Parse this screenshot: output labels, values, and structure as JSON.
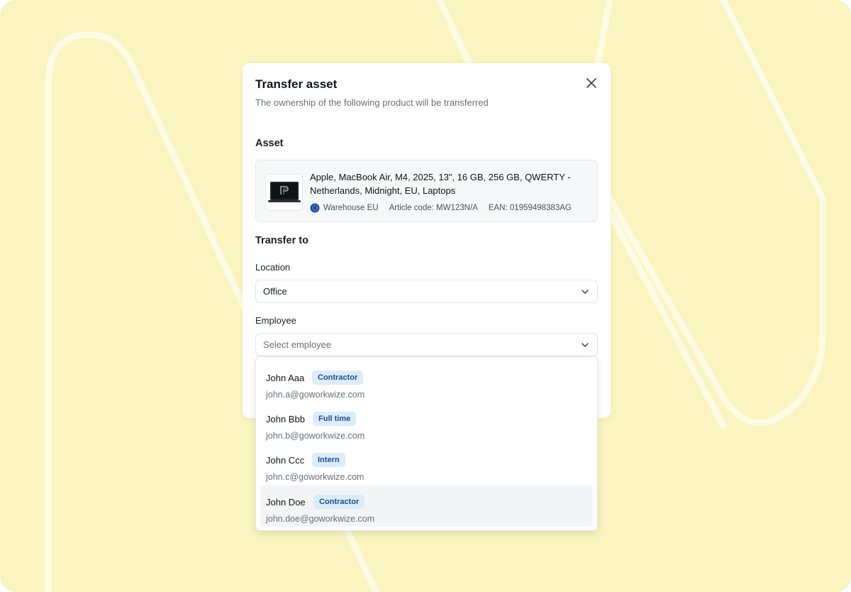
{
  "modal": {
    "title": "Transfer asset",
    "subtitle": "The ownership of the following product will be transferred"
  },
  "asset_section": {
    "label": "Asset",
    "product_name": "Apple, MacBook Air, M4, 2025, 13\", 16 GB, 256 GB, QWERTY - Netherlands, Midnight, EU, Laptops",
    "warehouse": "Warehouse EU",
    "article_code": "Article code: MW123N/A",
    "ean": "EAN: 01959498383AG"
  },
  "transfer_section": {
    "label": "Transfer to",
    "location_label": "Location",
    "location_value": "Office",
    "employee_label": "Employee",
    "employee_placeholder": "Select employee"
  },
  "dropdown": {
    "options": [
      {
        "name": "John Aaa",
        "badge": "Contractor",
        "email": "john.a@goworkwize.com"
      },
      {
        "name": "John Bbb",
        "badge": "Full time",
        "email": "john.b@goworkwize.com"
      },
      {
        "name": "John Ccc",
        "badge": "Intern",
        "email": "john.c@goworkwize.com"
      },
      {
        "name": "John Doe",
        "badge": "Contractor",
        "email": "john.doe@goworkwize.com"
      }
    ],
    "highlighted_index": 3
  },
  "colors": {
    "background": "#faf5c0",
    "badge_bg": "#dcecfb",
    "badge_text": "#1d4f8a"
  },
  "icons": {
    "close": "close-icon",
    "chevron": "chevron-down-icon",
    "globe": "globe-icon",
    "product": "laptop-thumbnail"
  }
}
